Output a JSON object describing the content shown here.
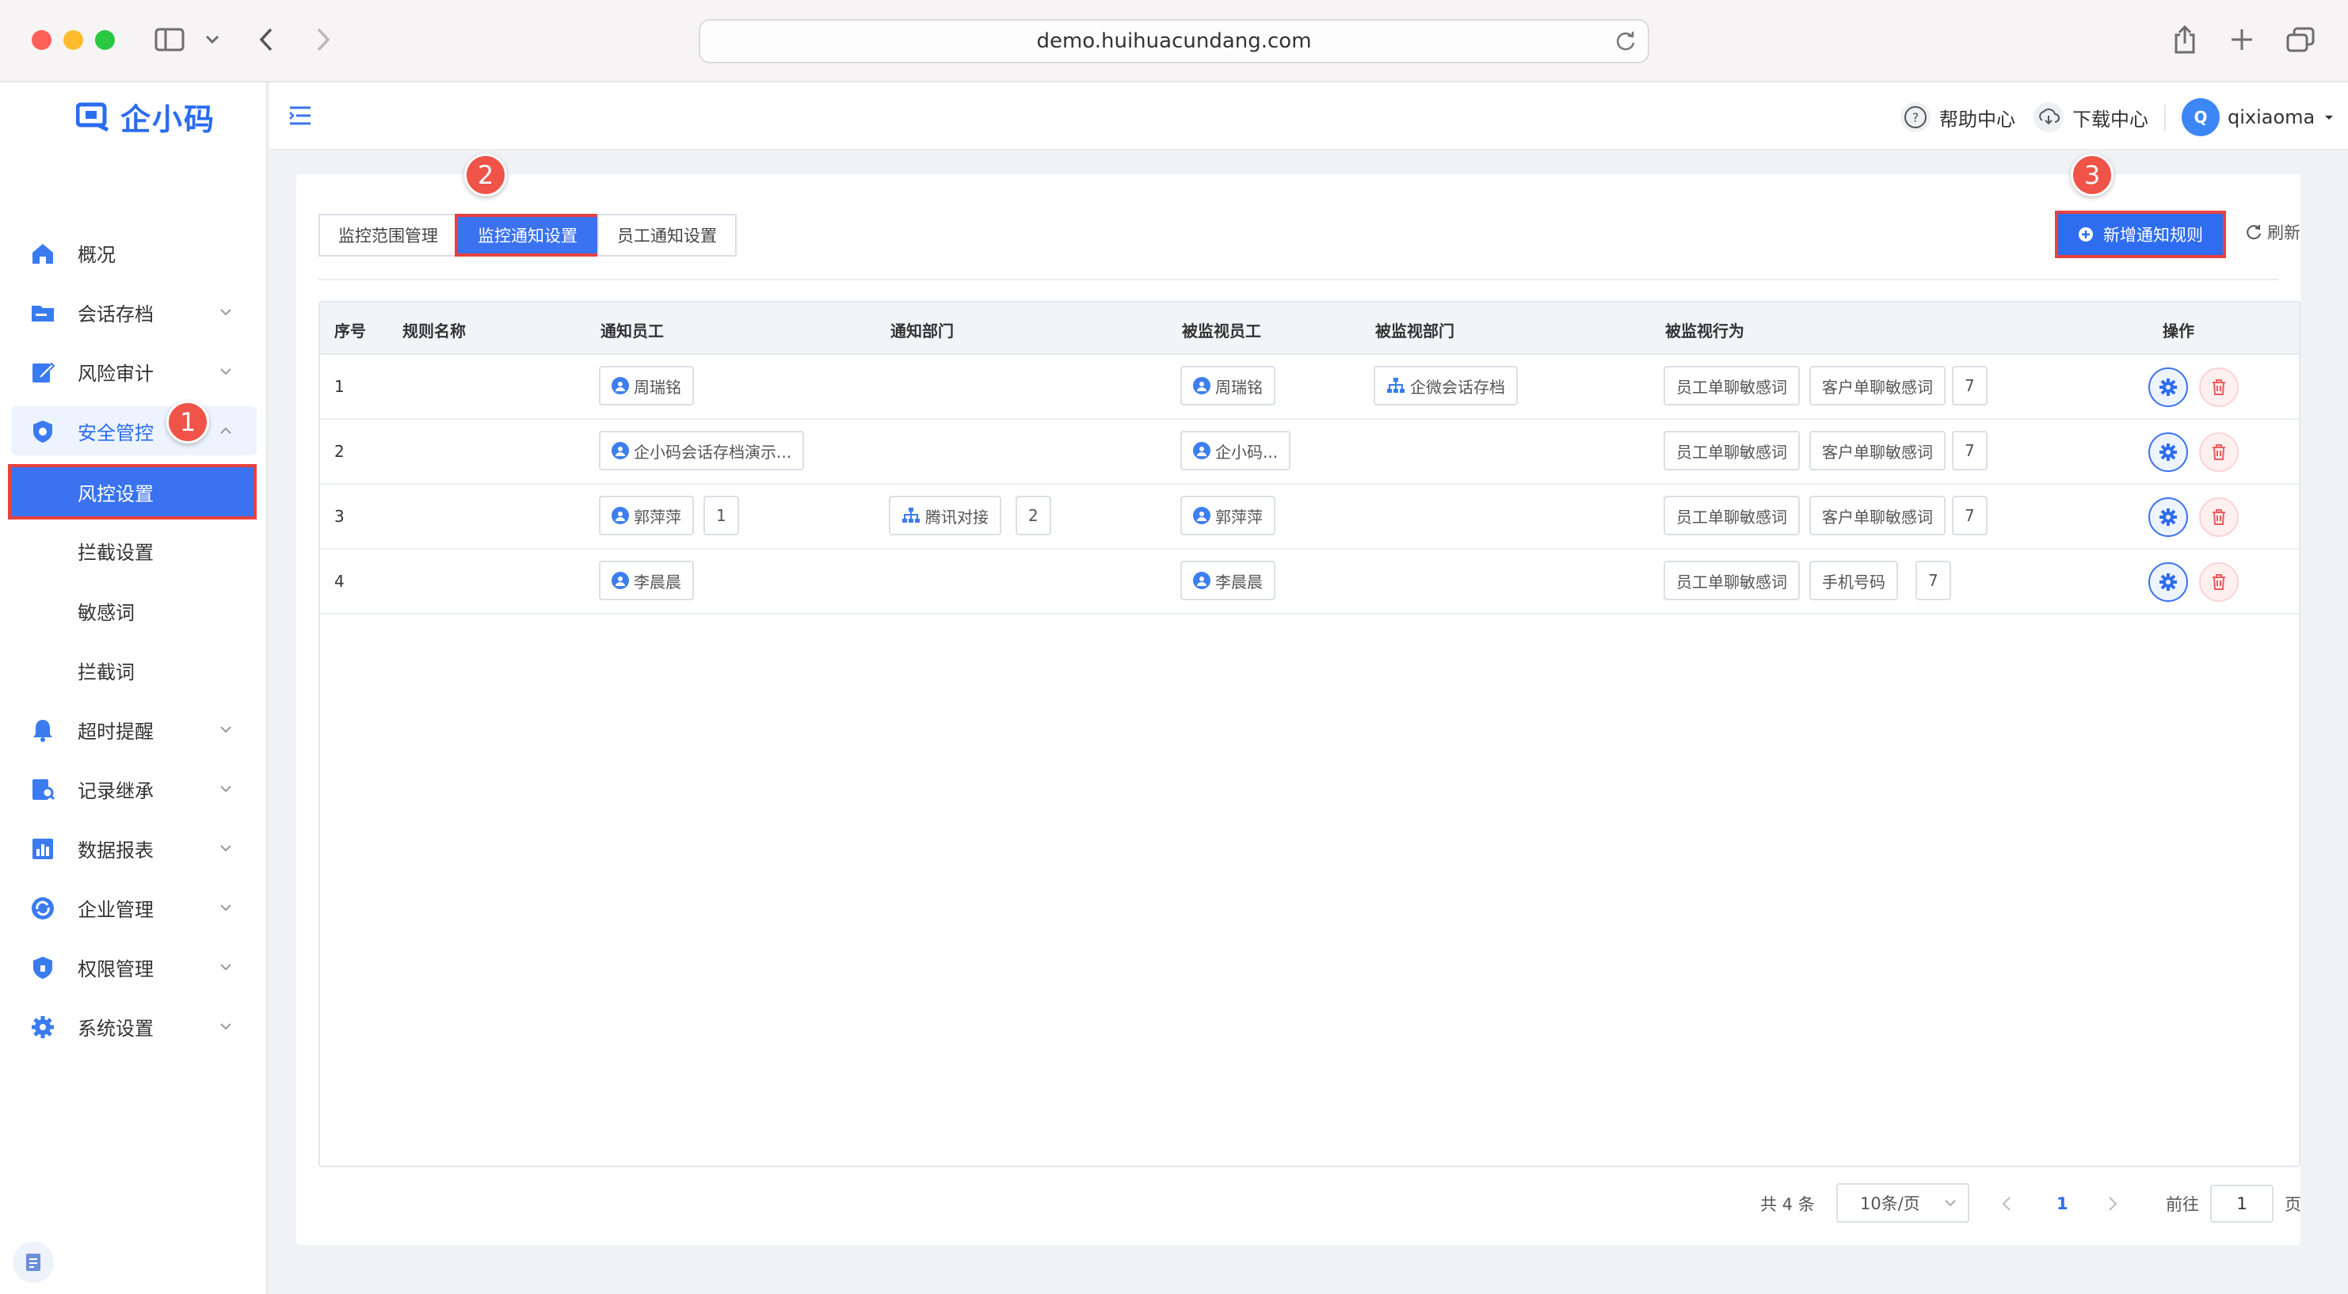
{
  "browser": {
    "url": "demo.huihuacundang.com"
  },
  "brand": {
    "logo_text": "企小码",
    "accent": "#2e6cf0",
    "highlight": "#e8423f"
  },
  "sidebar": {
    "items": [
      {
        "label": "概况",
        "icon": "home-icon"
      },
      {
        "label": "会话存档",
        "icon": "folder-icon"
      },
      {
        "label": "风险审计",
        "icon": "edit-icon"
      },
      {
        "label": "安全管控",
        "icon": "shield-icon"
      },
      {
        "label": "超时提醒",
        "icon": "bell-icon"
      },
      {
        "label": "记录继承",
        "icon": "record-icon"
      },
      {
        "label": "数据报表",
        "icon": "chart-icon"
      },
      {
        "label": "企业管理",
        "icon": "refresh-circle-icon"
      },
      {
        "label": "权限管理",
        "icon": "lock-shield-icon"
      },
      {
        "label": "系统设置",
        "icon": "gear-icon"
      }
    ],
    "sub_items": [
      "风控设置",
      "拦截设置",
      "敏感词",
      "拦截词"
    ]
  },
  "header": {
    "help": "帮助中心",
    "download": "下载中心",
    "avatar_letter": "Q",
    "username": "qixiaoma"
  },
  "steps": [
    "1",
    "2",
    "3"
  ],
  "tabs": [
    "监控范围管理",
    "监控通知设置",
    "员工通知设置"
  ],
  "actions": {
    "add": "新增通知规则",
    "refresh": "刷新"
  },
  "table": {
    "headers": [
      "序号",
      "规则名称",
      "通知员工",
      "通知部门",
      "被监视员工",
      "被监视部门",
      "被监视行为",
      "操作"
    ],
    "rows": [
      {
        "idx": "1",
        "notify_staff": "周瑞铭",
        "notify_staff_more": "",
        "notify_dept": "",
        "notify_dept_more": "",
        "watched_staff": "周瑞铭",
        "watched_dept": "企微会话存档",
        "behaviors": [
          "员工单聊敏感词",
          "客户单聊敏感词"
        ],
        "behavior_more": "7"
      },
      {
        "idx": "2",
        "notify_staff": "企小码会话存档演示...",
        "notify_staff_more": "",
        "notify_dept": "",
        "notify_dept_more": "",
        "watched_staff": "企小码...",
        "watched_dept": "",
        "behaviors": [
          "员工单聊敏感词",
          "客户单聊敏感词"
        ],
        "behavior_more": "7"
      },
      {
        "idx": "3",
        "notify_staff": "郭萍萍",
        "notify_staff_more": "1",
        "notify_dept": "腾讯对接",
        "notify_dept_more": "2",
        "watched_staff": "郭萍萍",
        "watched_dept": "",
        "behaviors": [
          "员工单聊敏感词",
          "客户单聊敏感词"
        ],
        "behavior_more": "7"
      },
      {
        "idx": "4",
        "notify_staff": "李晨晨",
        "notify_staff_more": "",
        "notify_dept": "",
        "notify_dept_more": "",
        "watched_staff": "李晨晨",
        "watched_dept": "",
        "behaviors": [
          "员工单聊敏感词",
          "手机号码"
        ],
        "behavior_more": "7"
      }
    ]
  },
  "pagination": {
    "total": "共 4 条",
    "page_size": "10条/页",
    "current": "1",
    "goto_label": "前往",
    "goto_value": "1",
    "page_suffix": "页"
  }
}
